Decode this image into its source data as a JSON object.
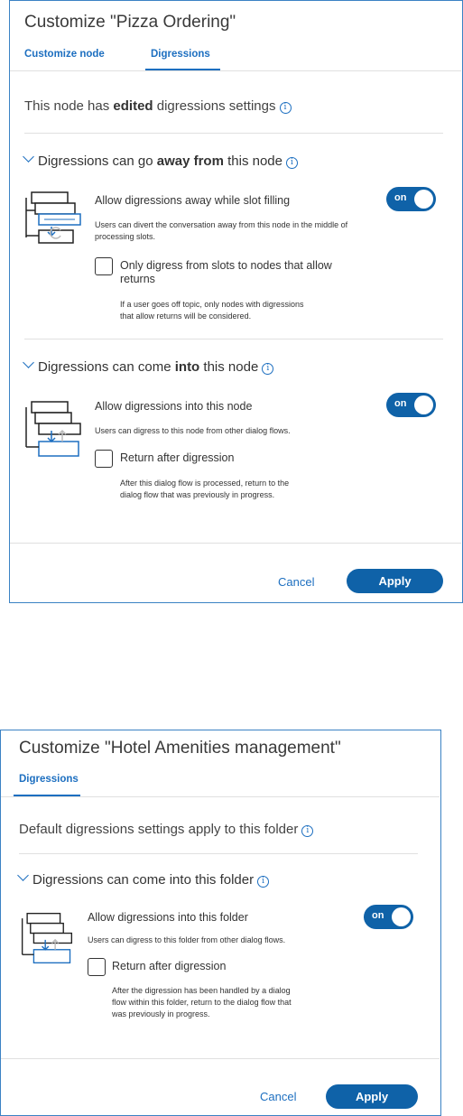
{
  "panel1": {
    "title": "Customize \"Pizza Ordering\"",
    "tabs": [
      "Customize node",
      "Digressions"
    ],
    "status_pre": "This node has ",
    "status_bold": "edited",
    "status_post": " digressions settings",
    "away": {
      "heading_pre": "Digressions can go ",
      "heading_bold": "away from",
      "heading_post": " this node",
      "toggle_label": "Allow digressions away while slot filling",
      "toggle_state": "on",
      "help_line1": "Users can divert the conversation away from this node in the middle of",
      "help_line2": "processing slots.",
      "checkbox_line1": "Only digress from slots to nodes that allow",
      "checkbox_line2": "returns",
      "checkbox_help1": "If a user goes off topic, only nodes with digressions",
      "checkbox_help2": "that allow returns will be considered."
    },
    "into": {
      "heading_pre": "Digressions can come ",
      "heading_bold": "into",
      "heading_post": " this node",
      "toggle_label": "Allow digressions into this node",
      "toggle_state": "on",
      "help_line1": "Users can digress to this node from other dialog flows.",
      "checkbox_label": "Return after digression",
      "checkbox_help1": "After this dialog flow is processed, return to the",
      "checkbox_help2": "dialog flow that was previously in progress."
    },
    "cancel": "Cancel",
    "apply": "Apply"
  },
  "panel2": {
    "title": "Customize \"Hotel Amenities management\"",
    "tab": "Digressions",
    "status": "Default digressions settings apply to this folder",
    "into": {
      "heading": "Digressions can come into this folder",
      "toggle_label": "Allow digressions into this folder",
      "toggle_state": "on",
      "help_line1": "Users can digress to this folder from other dialog flows.",
      "checkbox_label": "Return after digression",
      "checkbox_help1": "After the digression has been handled by a dialog",
      "checkbox_help2": "flow within this folder, return to the dialog flow that",
      "checkbox_help3": "was previously in progress."
    },
    "cancel": "Cancel",
    "apply": "Apply"
  },
  "colors": {
    "accent": "#1d6fc0",
    "button": "#0f62a8",
    "border": "#3b82c4"
  },
  "icons": [
    "info-icon",
    "chevron-down-icon",
    "digression-away-illustration",
    "digression-into-illustration"
  ]
}
